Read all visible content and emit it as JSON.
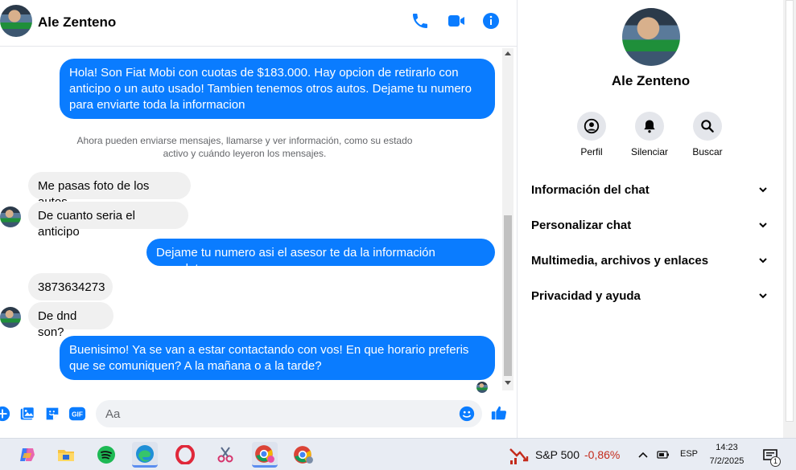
{
  "header": {
    "contact_name": "Ale Zenteno"
  },
  "messages": {
    "m1": "Hola! Son Fiat Mobi con cuotas de $183.000. Hay opcion de retirarlo con anticipo o un auto usado! Tambien tenemos otros autos. Dejame tu numero para enviarte toda la informacion",
    "system_notice": "Ahora pueden enviarse mensajes, llamarse y ver información, como su estado activo y cuándo leyeron los mensajes.",
    "m2": "Me pasas foto de los autos",
    "m3": "De cuanto seria el anticipo",
    "m4": "Dejame tu numero asi el asesor te da la información completa",
    "m5": "3873634273",
    "m6": "De dnd son?",
    "m7": "Buenisimo! Ya se van a estar contactando con vos! En que horario preferis que se comuniquen? A la mañana o a la tarde?"
  },
  "composer": {
    "placeholder": "Aa",
    "gif_label": "GIF"
  },
  "profile": {
    "name": "Ale Zenteno",
    "actions": {
      "perfil": "Perfil",
      "silenciar": "Silenciar",
      "buscar": "Buscar"
    },
    "sections": [
      "Información del chat",
      "Personalizar chat",
      "Multimedia, archivos y enlaces",
      "Privacidad y ayuda"
    ]
  },
  "taskbar": {
    "stock_name": "S&P 500",
    "stock_change": "-0,86%",
    "language": "ESP",
    "time": "14:23",
    "date": "7/2/2025",
    "notification_count": "1"
  },
  "colors": {
    "accent": "#0a7cff",
    "incoming_bubble": "#f0f0f0",
    "negative": "#c42b1c"
  }
}
